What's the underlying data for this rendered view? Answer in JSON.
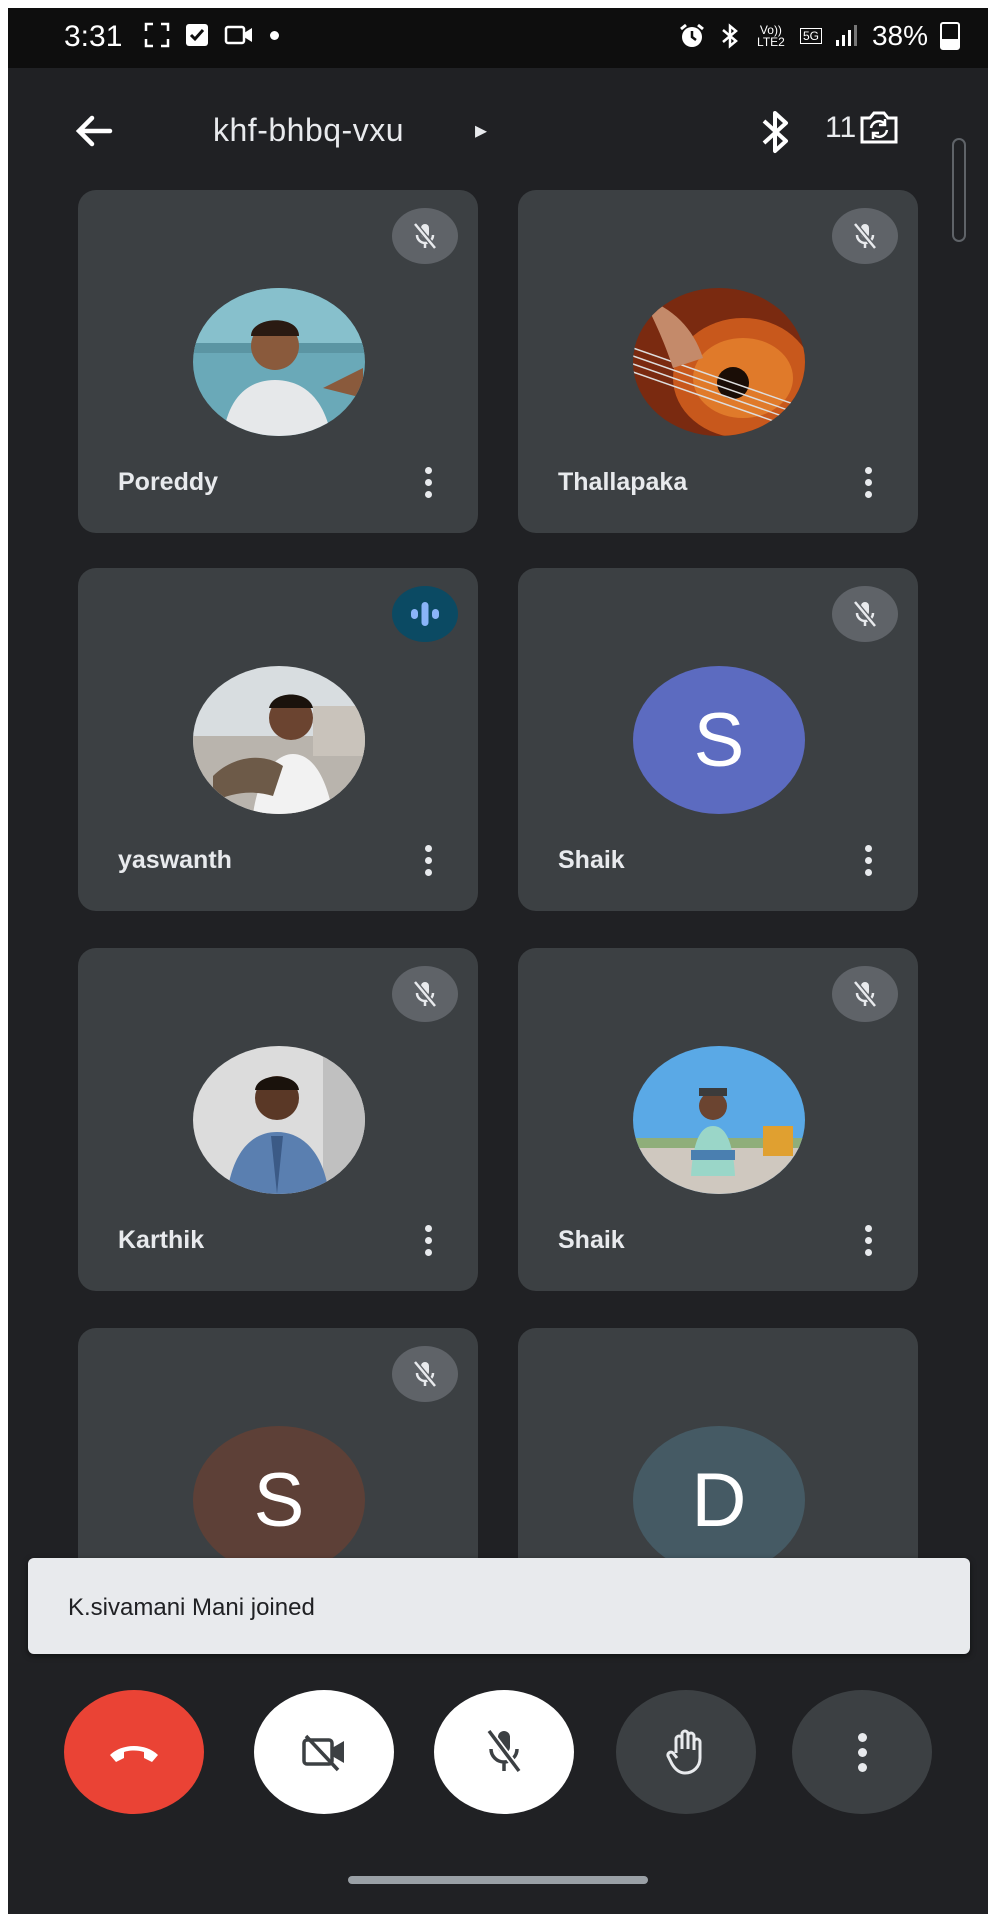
{
  "status_bar": {
    "time": "3:31",
    "volte": "Vo)) LTE2",
    "network": "5G",
    "battery": "38%"
  },
  "header": {
    "meeting_code": "khf-bhbq-vxu",
    "caret": "▸",
    "participant_count": "11"
  },
  "tiles": [
    {
      "name": "Poreddy",
      "status": "muted",
      "avatar": "photo"
    },
    {
      "name": "Thallapaka",
      "status": "muted",
      "avatar": "photo"
    },
    {
      "name": "yaswanth",
      "status": "speaking",
      "avatar": "photo"
    },
    {
      "name": "Shaik",
      "status": "muted",
      "avatar": "letter",
      "letter": "S",
      "color": "#5c6bc0"
    },
    {
      "name": "Karthik",
      "status": "muted",
      "avatar": "photo"
    },
    {
      "name": "Shaik",
      "status": "muted",
      "avatar": "photo"
    },
    {
      "name": "",
      "status": "muted",
      "avatar": "letter",
      "letter": "S",
      "color": "#5d4037"
    },
    {
      "name": "",
      "status": "none",
      "avatar": "letter",
      "letter": "D",
      "color": "#455a64"
    }
  ],
  "toast": {
    "message": "K.sivamani Mani joined"
  },
  "colors": {
    "background": "#202124",
    "tile": "#3c4043",
    "hangup": "#ea4335",
    "speaking": "#0b4a63"
  },
  "icons": {
    "hangup": "phone-hangup-icon",
    "video": "video-off-icon",
    "mic": "mic-off-icon",
    "hand": "raise-hand-icon",
    "more": "more-vert-icon"
  }
}
